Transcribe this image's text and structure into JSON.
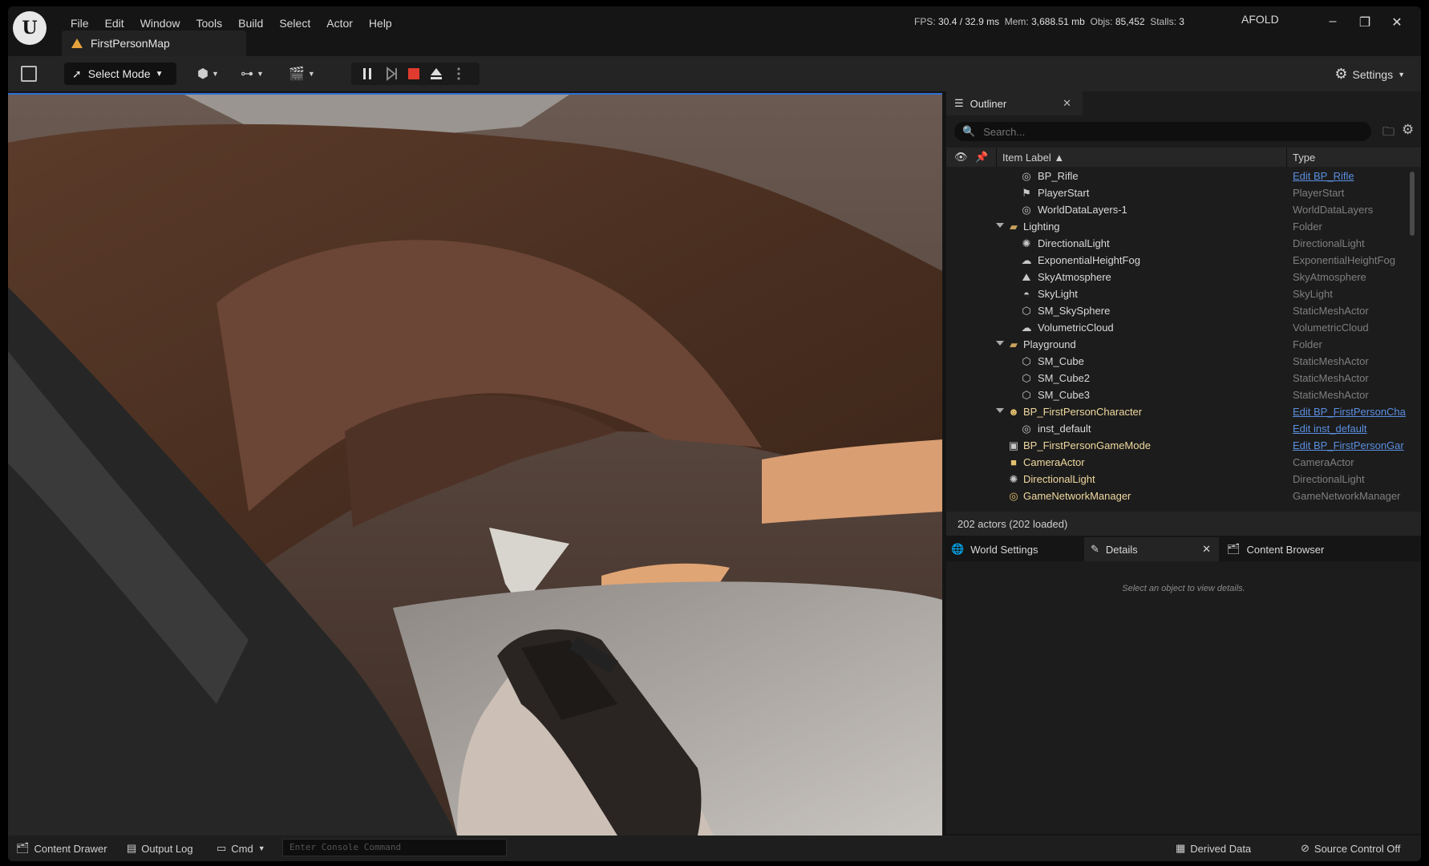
{
  "menu": [
    "File",
    "Edit",
    "Window",
    "Tools",
    "Build",
    "Select",
    "Actor",
    "Help"
  ],
  "stats": {
    "fps_label": "FPS:",
    "fps_value": "30.4",
    "ms_value": "/ 32.9 ms",
    "mem_label": "Mem:",
    "mem_value": "3,688.51 mb",
    "objs_label": "Objs:",
    "objs_value": "85,452",
    "stalls_label": "Stalls:",
    "stalls_value": "3"
  },
  "project_name": "AFOLD",
  "map_tab": "FirstPersonMap",
  "toolbar": {
    "select_mode": "Select Mode",
    "settings": "Settings"
  },
  "outliner": {
    "tab": "Outliner",
    "search_placeholder": "Search...",
    "col_label": "Item Label ▲",
    "col_type": "Type",
    "footer": "202 actors (202 loaded)",
    "rows": [
      {
        "label": "BP_Rifle",
        "type": "Edit BP_Rifle",
        "link": true
      },
      {
        "label": "PlayerStart",
        "type": "PlayerStart"
      },
      {
        "label": "WorldDataLayers-1",
        "type": "WorldDataLayers"
      },
      {
        "label": "Lighting",
        "type": "Folder"
      },
      {
        "label": "DirectionalLight",
        "type": "DirectionalLight"
      },
      {
        "label": "ExponentialHeightFog",
        "type": "ExponentialHeightFog"
      },
      {
        "label": "SkyAtmosphere",
        "type": "SkyAtmosphere"
      },
      {
        "label": "SkyLight",
        "type": "SkyLight"
      },
      {
        "label": "SM_SkySphere",
        "type": "StaticMeshActor"
      },
      {
        "label": "VolumetricCloud",
        "type": "VolumetricCloud"
      },
      {
        "label": "Playground",
        "type": "Folder"
      },
      {
        "label": "SM_Cube",
        "type": "StaticMeshActor"
      },
      {
        "label": "SM_Cube2",
        "type": "StaticMeshActor"
      },
      {
        "label": "SM_Cube3",
        "type": "StaticMeshActor"
      },
      {
        "label": "BP_FirstPersonCharacter",
        "type": "Edit BP_FirstPersonCha",
        "link": true
      },
      {
        "label": "inst_default",
        "type": "Edit inst_default",
        "link": true
      },
      {
        "label": "BP_FirstPersonGameMode",
        "type": "Edit BP_FirstPersonGar",
        "link": true
      },
      {
        "label": "CameraActor",
        "type": "CameraActor"
      },
      {
        "label": "DirectionalLight",
        "type": "DirectionalLight"
      },
      {
        "label": "GameNetworkManager",
        "type": "GameNetworkManager"
      }
    ]
  },
  "details": {
    "tab_world": "World Settings",
    "tab_details": "Details",
    "tab_content": "Content Browser",
    "empty_msg": "Select an object to view details."
  },
  "statusbar": {
    "content_drawer": "Content Drawer",
    "output_log": "Output Log",
    "cmd": "Cmd",
    "console_placeholder": "Enter Console Command",
    "derived_data": "Derived Data",
    "source_control": "Source Control Off"
  }
}
